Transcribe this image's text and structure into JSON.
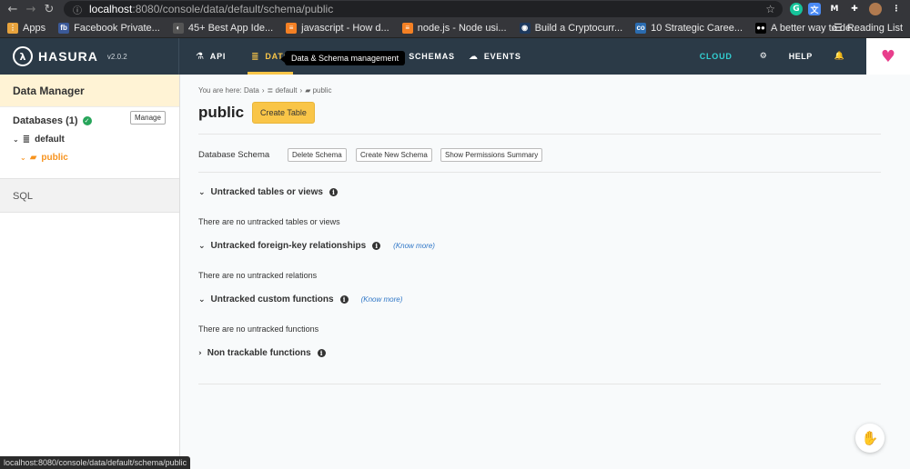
{
  "browser": {
    "url_host": "localhost",
    "url_path": ":8080/console/data/default/schema/public",
    "bookmarks": [
      {
        "label": "Apps",
        "icon": "apps-grid-icon",
        "color": "#e8a33d",
        "glyph": "⋮"
      },
      {
        "label": "Facebook Private...",
        "icon": "facebook-icon",
        "color": "#3b5998",
        "glyph": "fb"
      },
      {
        "label": "45+ Best App Ide...",
        "icon": "globe-icon",
        "color": "#555555",
        "glyph": "◐"
      },
      {
        "label": "javascript - How d...",
        "icon": "stackoverflow-icon",
        "color": "#f48024",
        "glyph": "≡"
      },
      {
        "label": "node.js - Node usi...",
        "icon": "stackoverflow-icon",
        "color": "#f48024",
        "glyph": "≡"
      },
      {
        "label": "Build a Cryptocurr...",
        "icon": "site-icon",
        "color": "#1e3a5f",
        "glyph": "◉"
      },
      {
        "label": "10 Strategic Caree...",
        "icon": "co-icon",
        "color": "#2b6cb0",
        "glyph": "co"
      },
      {
        "label": "A better way to de...",
        "icon": "medium-icon",
        "color": "#000000",
        "glyph": "●●"
      }
    ],
    "reading_list": "Reading List",
    "status_url": "localhost:8080/console/data/default/schema/public"
  },
  "nav": {
    "logo": "HASURA",
    "version": "v2.0.2",
    "tabs": [
      {
        "label": "API",
        "icon": "flask-icon",
        "glyph": "⚗",
        "active": false
      },
      {
        "label": "DATA",
        "icon": "database-icon",
        "glyph": "≣",
        "active": true
      },
      {
        "label": "OTE SCHEMAS",
        "icon": "remote-schema-icon",
        "glyph": "",
        "active": false
      },
      {
        "label": "EVENTS",
        "icon": "cloud-icon",
        "glyph": "☁",
        "active": false
      }
    ],
    "tooltip": "Data & Schema management",
    "cloud": "CLOUD",
    "help": "HELP"
  },
  "sidebar": {
    "header": "Data Manager",
    "databases_label": "Databases (1)",
    "manage": "Manage",
    "db_name": "default",
    "schema_name": "public",
    "sql": "SQL"
  },
  "main": {
    "breadcrumb": {
      "prefix": "You are here: Data",
      "db": "default",
      "schema": "public"
    },
    "title": "public",
    "create_table": "Create Table",
    "schema_label": "Database Schema",
    "schema_buttons": [
      "Delete Schema",
      "Create New Schema",
      "Show Permissions Summary"
    ],
    "sections": [
      {
        "title": "Untracked tables or views",
        "chevron": "v",
        "know_more": "",
        "empty": "There are no untracked tables or views"
      },
      {
        "title": "Untracked foreign-key relationships",
        "chevron": "v",
        "know_more": "(Know more)",
        "empty": "There are no untracked relations"
      },
      {
        "title": "Untracked custom functions",
        "chevron": "v",
        "know_more": "(Know more)",
        "empty": "There are no untracked functions"
      },
      {
        "title": "Non trackable functions",
        "chevron": ">",
        "know_more": "",
        "empty": ""
      }
    ]
  },
  "colors": {
    "accent": "#f9c548",
    "nav_bg": "#2b3a47",
    "cloud": "#32d0d3",
    "schema_active": "#f7931e"
  }
}
